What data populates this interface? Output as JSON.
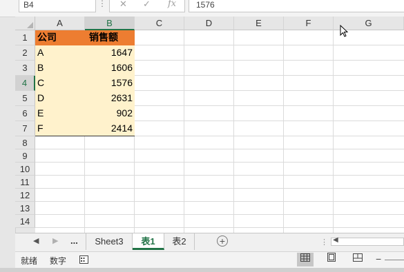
{
  "formula_bar": {
    "name_box": "B4",
    "separator": "⋮",
    "cancel_symbol": "✕",
    "enter_symbol": "✓",
    "fx_label": "fx",
    "content": "1576"
  },
  "columns": [
    "A",
    "B",
    "C",
    "D",
    "E",
    "F",
    "G"
  ],
  "rows": [
    "1",
    "2",
    "3",
    "4",
    "5",
    "6",
    "7",
    "8",
    "9",
    "10",
    "11",
    "12",
    "13",
    "14"
  ],
  "table": {
    "headers": [
      "公司",
      "销售额"
    ],
    "rows": [
      {
        "company": "A",
        "sales": "1647"
      },
      {
        "company": "B",
        "sales": "1606"
      },
      {
        "company": "C",
        "sales": "1576"
      },
      {
        "company": "D",
        "sales": "2631"
      },
      {
        "company": "E",
        "sales": "902"
      },
      {
        "company": "F",
        "sales": "2414"
      }
    ],
    "header_color": "#ed7d31",
    "body_color": "#fff2cc"
  },
  "sheet_tabs": {
    "nav_prev": "◀",
    "nav_next": "▶",
    "ellipsis": "...",
    "tabs": [
      "Sheet3",
      "表1",
      "表2"
    ],
    "active_tab": "表1",
    "add_label": "+"
  },
  "status_bar": {
    "ready": "就绪",
    "num": "数字",
    "zoom_minus": "−"
  },
  "accent_color": "#217346"
}
